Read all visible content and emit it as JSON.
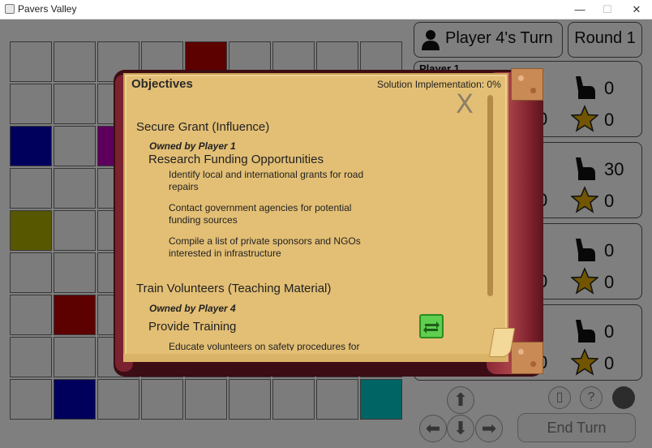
{
  "window": {
    "title": "Pavers Valley",
    "controls": [
      "—",
      "☐",
      "✕"
    ]
  },
  "header": {
    "turn": "Player 4's Turn",
    "round": "Round 1"
  },
  "board": {
    "rows": [
      [
        "#eeeeee",
        "#eeeeee",
        "#eeeeee",
        "#eeeeee",
        "#b00000",
        "#eeeeee",
        "#eeeeee",
        "#eeeeee",
        "#eeeeee"
      ],
      [
        "#eeeeee",
        "#eeeeee",
        "#eeeeee",
        "#eeeeee",
        "#eeeeee",
        "#eeeeee",
        "#eeeeee",
        "#eeeeee",
        "#eeeeee"
      ],
      [
        "#0000b0",
        "#eeeeee",
        "#b000b0",
        "#eeeeee",
        "#eeeeee",
        "#eeeeee",
        "#eeeeee",
        "#eeeeee",
        "#eeeeee"
      ],
      [
        "#eeeeee",
        "#eeeeee",
        "#eeeeee",
        "#eeeeee",
        "#eeeeee",
        "#eeeeee",
        "#eeeeee",
        "#eeeeee",
        "#eeeeee"
      ],
      [
        "#a8a800",
        "#eeeeee",
        "#eeeeee",
        "#eeeeee",
        "#eeeeee",
        "#eeeeee",
        "#eeeeee",
        "#eeeeee",
        "#eeeeee"
      ],
      [
        "#eeeeee",
        "#eeeeee",
        "#eeeeee",
        "#eeeeee",
        "#eeeeee",
        "#eeeeee",
        "#eeeeee",
        "#eeeeee",
        "#eeeeee"
      ],
      [
        "#eeeeee",
        "#b00000",
        "#eeeeee",
        "#eeeeee",
        "#eeeeee",
        "#eeeeee",
        "#eeeeee",
        "#eeeeee",
        "#eeeeee"
      ],
      [
        "#eeeeee",
        "#eeeeee",
        "#eeeeee",
        "#eeeeee",
        "#00c0c0",
        "#eeeeee",
        "#b00000",
        "#eeeeee",
        "#eeeeee"
      ],
      [
        "#eeeeee",
        "#0000b0",
        "#eeeeee",
        "#eeeeee",
        "#eeeeee",
        "#eeeeee",
        "#eeeeee",
        "#eeeeee",
        "#00c0c0"
      ]
    ]
  },
  "players": [
    {
      "name": "Player 1",
      "hands": "0",
      "stars": "0",
      "left_value": "0"
    },
    {
      "name": "",
      "hands": "30",
      "stars": "0",
      "left_value": "0"
    },
    {
      "name": "",
      "hands": "0",
      "stars": "0",
      "left_value": "0"
    },
    {
      "name": "",
      "hands": "0",
      "stars": "0",
      "left_value": "0"
    }
  ],
  "controls": {
    "end_turn": "End Turn",
    "help_icon": "?"
  },
  "objectives": {
    "title": "Objectives",
    "solution_label": "Solution Implementation: 0%",
    "close_label": "X",
    "goals": [
      {
        "name": "Secure Grant (Influence)",
        "owner": "Owned by Player 1",
        "task": "Research Funding Opportunities",
        "subtasks": [
          "Identify local and international grants for road repairs",
          "Contact government agencies for potential funding sources",
          "Compile a list of private sponsors and NGOs interested in infrastructure"
        ]
      },
      {
        "name": "Train Volunteers (Teaching Material)",
        "owner": "Owned by Player 4",
        "task": "Provide Training",
        "subtasks": [
          "Educate volunteers on safety procedures for road repairs"
        ]
      }
    ]
  }
}
